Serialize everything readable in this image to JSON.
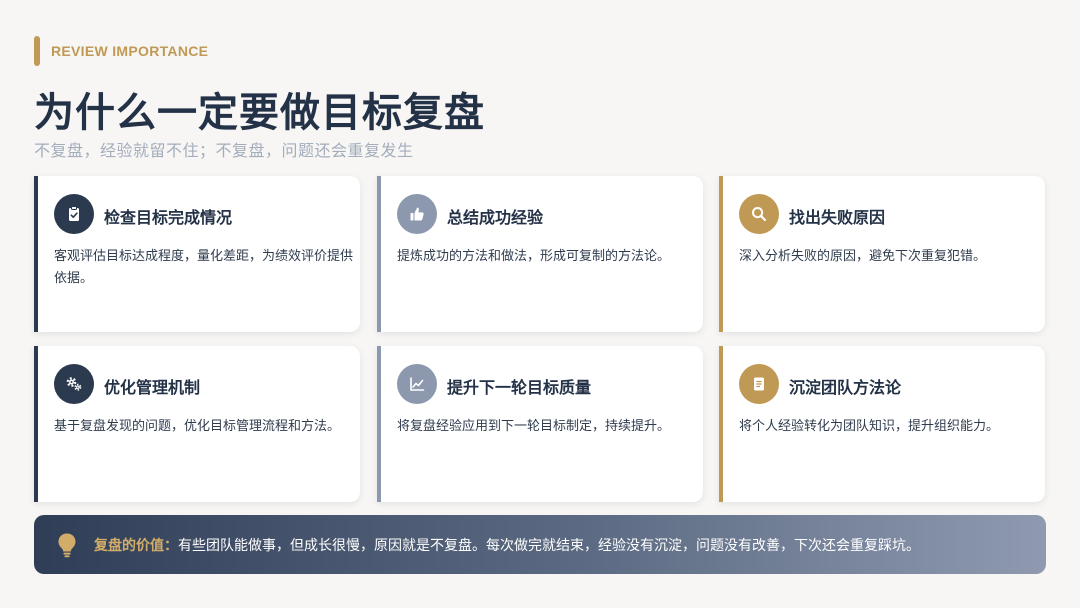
{
  "header": {
    "eyebrow": "REVIEW IMPORTANCE",
    "title": "为什么一定要做目标复盘",
    "subtitle": "不复盘，经验就留不住；不复盘，问题还会重复发生"
  },
  "colors": {
    "navy": "#2c3a4f",
    "steel": "#8c98ad",
    "gold": "#c09a55",
    "background": "#f7f6f4"
  },
  "cards": [
    {
      "icon": "clipboard-check-icon",
      "accent": "navy",
      "title": "检查目标完成情况",
      "desc": "客观评估目标达成程度，量化差距，为绩效评价提供依据。"
    },
    {
      "icon": "thumbs-up-icon",
      "accent": "steel",
      "title": "总结成功经验",
      "desc": "提炼成功的方法和做法，形成可复制的方法论。"
    },
    {
      "icon": "search-icon",
      "accent": "gold",
      "title": "找出失败原因",
      "desc": "深入分析失败的原因，避免下次重复犯错。"
    },
    {
      "icon": "gears-icon",
      "accent": "navy",
      "title": "优化管理机制",
      "desc": "基于复盘发现的问题，优化目标管理流程和方法。"
    },
    {
      "icon": "chart-line-icon",
      "accent": "steel",
      "title": "提升下一轮目标质量",
      "desc": "将复盘经验应用到下一轮目标制定，持续提升。"
    },
    {
      "icon": "document-icon",
      "accent": "gold",
      "title": "沉淀团队方法论",
      "desc": "将个人经验转化为团队知识，提升组织能力。"
    }
  ],
  "banner": {
    "icon": "lightbulb-icon",
    "label": "复盘的价值：",
    "text": "有些团队能做事，但成长很慢，原因就是不复盘。每次做完就结束，经验没有沉淀，问题没有改善，下次还会重复踩坑。"
  }
}
